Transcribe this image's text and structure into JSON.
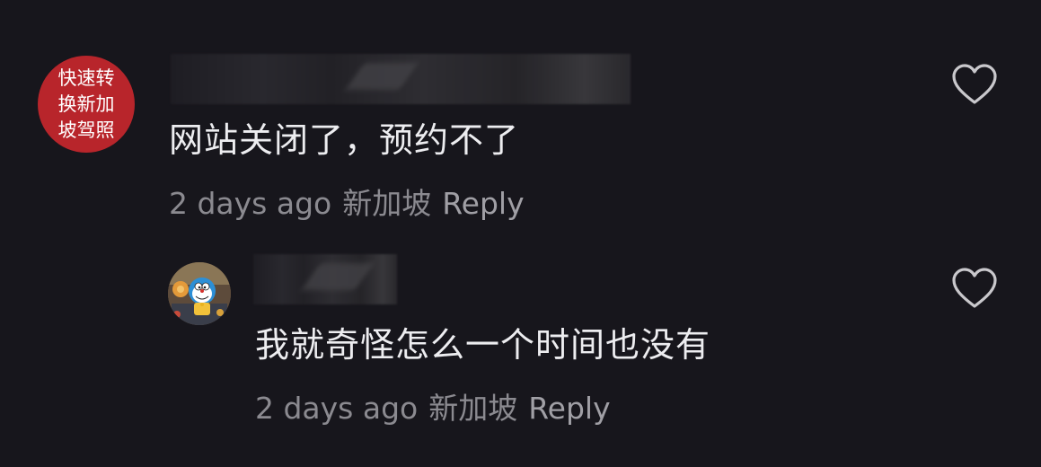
{
  "comments": [
    {
      "avatar": {
        "text": "快速转\n换新加\n坡驾照",
        "color": "#b8252b"
      },
      "text": "网站关闭了，预约不了",
      "time": "2 days ago",
      "location": "新加坡",
      "reply_label": "Reply",
      "icon": "heart-outline-icon"
    },
    {
      "avatar": {
        "icon": "doraemon-avatar"
      },
      "text": "我就奇怪怎么一个时间也没有",
      "time": "2 days ago",
      "location": "新加坡",
      "reply_label": "Reply",
      "icon": "heart-outline-icon"
    }
  ]
}
